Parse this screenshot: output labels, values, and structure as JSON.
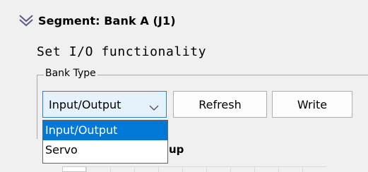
{
  "segment": {
    "title": "Segment: Bank A (J1)",
    "collapse_icon": "double-chevron-down-icon"
  },
  "section": {
    "title": "Set I/O functionality"
  },
  "bank_type": {
    "legend": "Bank Type",
    "selected_value": "Input/Output",
    "options": [
      "Input/Output",
      "Servo"
    ],
    "highlighted_option_index": 0
  },
  "buttons": {
    "refresh_label": "Refresh",
    "write_label": "Write"
  },
  "obscured_label": {
    "visible_text": "up"
  },
  "colors": {
    "selection": "#0078d7",
    "combo_focus_border": "#2b7fd9",
    "combo_focus_bg": "#e5f1fb",
    "window_bg": "#f0f0f0"
  }
}
